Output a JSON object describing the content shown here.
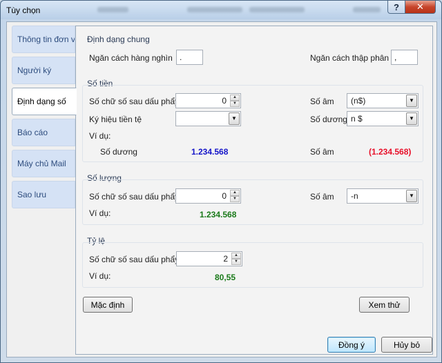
{
  "window": {
    "title": "Tùy chọn",
    "help_glyph": "?",
    "close_glyph": "✕"
  },
  "tabs": [
    {
      "label": "Thông tin đơn vị"
    },
    {
      "label": "Người ký"
    },
    {
      "label": "Định dạng số",
      "active": true
    },
    {
      "label": "Báo cáo"
    },
    {
      "label": "Máy chủ Mail"
    },
    {
      "label": "Sao lưu"
    }
  ],
  "general": {
    "title": "Định dạng chung",
    "thousand_label": "Ngăn cách hàng nghìn",
    "thousand_value": ".",
    "decimal_label": "Ngăn cách thập phân",
    "decimal_value": ","
  },
  "money": {
    "title": "Số tiền",
    "decimals_label": "Số chữ số sau dấu phẩy",
    "decimals_value": "0",
    "currency_label": "Ký hiệu tiền tệ",
    "currency_value": "",
    "negative_label": "Số âm",
    "negative_value": "(n$)",
    "positive_label": "Số dương",
    "positive_value": "n $",
    "example_label": "Ví dụ:",
    "ex_positive_label": "Số dương",
    "ex_positive_value": "1.234.568",
    "ex_negative_label": "Số âm",
    "ex_negative_value": "(1.234.568)"
  },
  "quantity": {
    "title": "Số lượng",
    "decimals_label": "Số chữ số sau dấu phẩy",
    "decimals_value": "0",
    "negative_label": "Số âm",
    "negative_value": "-n",
    "example_label": "Ví dụ:",
    "example_value": "1.234.568"
  },
  "ratio": {
    "title": "Tỷ lệ",
    "decimals_label": "Số chữ số sau dấu phẩy",
    "decimals_value": "2",
    "example_label": "Ví dụ:",
    "example_value": "80,55"
  },
  "buttons": {
    "default": "Mặc định",
    "preview": "Xem thử",
    "ok": "Đồng ý",
    "cancel": "Hủy bỏ"
  },
  "spin": {
    "up": "▲",
    "down": "▼"
  },
  "dropdown": {
    "arrow": "▼"
  },
  "colors": {
    "positive_example": "#1414c8",
    "negative_example": "#e8102a",
    "green_example": "#1a7a1a"
  }
}
